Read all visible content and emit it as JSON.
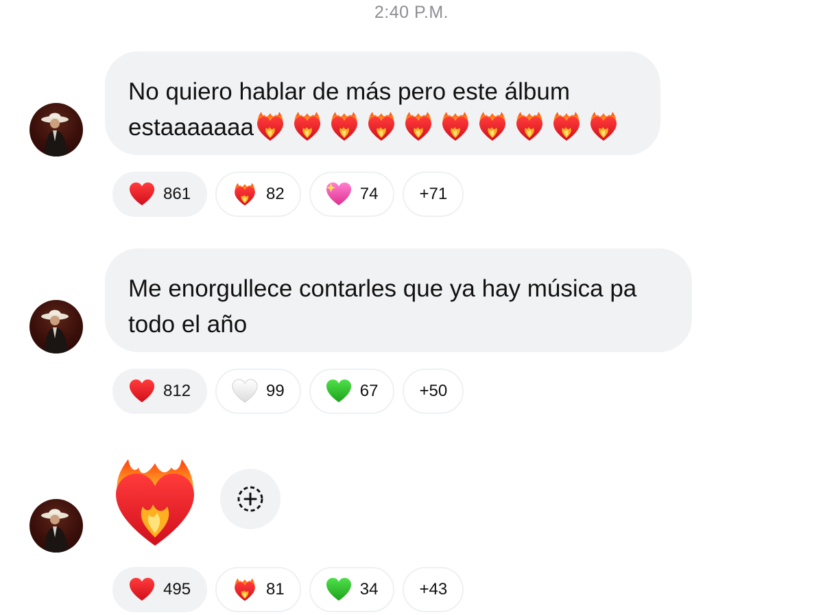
{
  "timestamp": "2:40 P.M.",
  "messages": [
    {
      "text": "No quiero hablar de más pero este álbum estaaaaaaa",
      "trailing_emoji": "heart-on-fire",
      "trailing_emoji_count": 10,
      "reactions": [
        {
          "emoji": "red-heart",
          "count": "861"
        },
        {
          "emoji": "heart-on-fire",
          "count": "82"
        },
        {
          "emoji": "sparkling-heart",
          "count": "74"
        },
        {
          "more": "+71"
        }
      ]
    },
    {
      "text": "Me enorgullece contarles que ya hay música pa todo el año",
      "reactions": [
        {
          "emoji": "red-heart",
          "count": "812"
        },
        {
          "emoji": "white-heart",
          "count": "99"
        },
        {
          "emoji": "green-heart",
          "count": "67"
        },
        {
          "more": "+50"
        }
      ]
    },
    {
      "emoji_message": "heart-on-fire",
      "reactions": [
        {
          "emoji": "red-heart",
          "count": "495"
        },
        {
          "emoji": "heart-on-fire",
          "count": "81"
        },
        {
          "emoji": "green-heart",
          "count": "34"
        },
        {
          "more": "+43"
        }
      ]
    }
  ]
}
